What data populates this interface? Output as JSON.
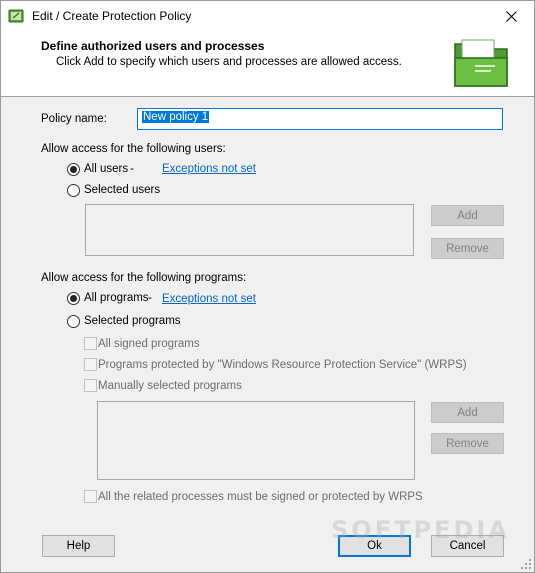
{
  "window": {
    "title": "Edit / Create Protection Policy"
  },
  "header": {
    "title": "Define authorized users and processes",
    "subtitle": "Click Add to specify which users and processes are allowed access."
  },
  "policy": {
    "label": "Policy name:",
    "value": "New policy 1"
  },
  "users": {
    "group_label": "Allow access for the following users:",
    "all_label": "All users",
    "dash": "-",
    "exceptions_link": "Exceptions not set",
    "selected_label": "Selected users",
    "add_label": "Add",
    "remove_label": "Remove"
  },
  "programs": {
    "group_label": "Allow access for the following programs:",
    "all_label": "All programs",
    "dash": "-",
    "exceptions_link": "Exceptions not set",
    "selected_label": "Selected programs",
    "opt_signed": "All signed programs",
    "opt_wrps": "Programs protected by \"Windows Resource Protection Service\" (WRPS)",
    "opt_manual": "Manually selected programs",
    "add_label": "Add",
    "remove_label": "Remove",
    "related_label": "All the related processes must be signed or protected by WRPS"
  },
  "footer": {
    "help_label": "Help",
    "ok_label": "Ok",
    "cancel_label": "Cancel"
  },
  "watermark": "SOFTPEDIA",
  "colors": {
    "accent": "#0078d7",
    "link": "#0066cc",
    "icon_green": "#5a9e3a"
  },
  "icons": {
    "app": "folder-shield-icon",
    "header": "folder-document-icon",
    "close": "close-icon"
  }
}
